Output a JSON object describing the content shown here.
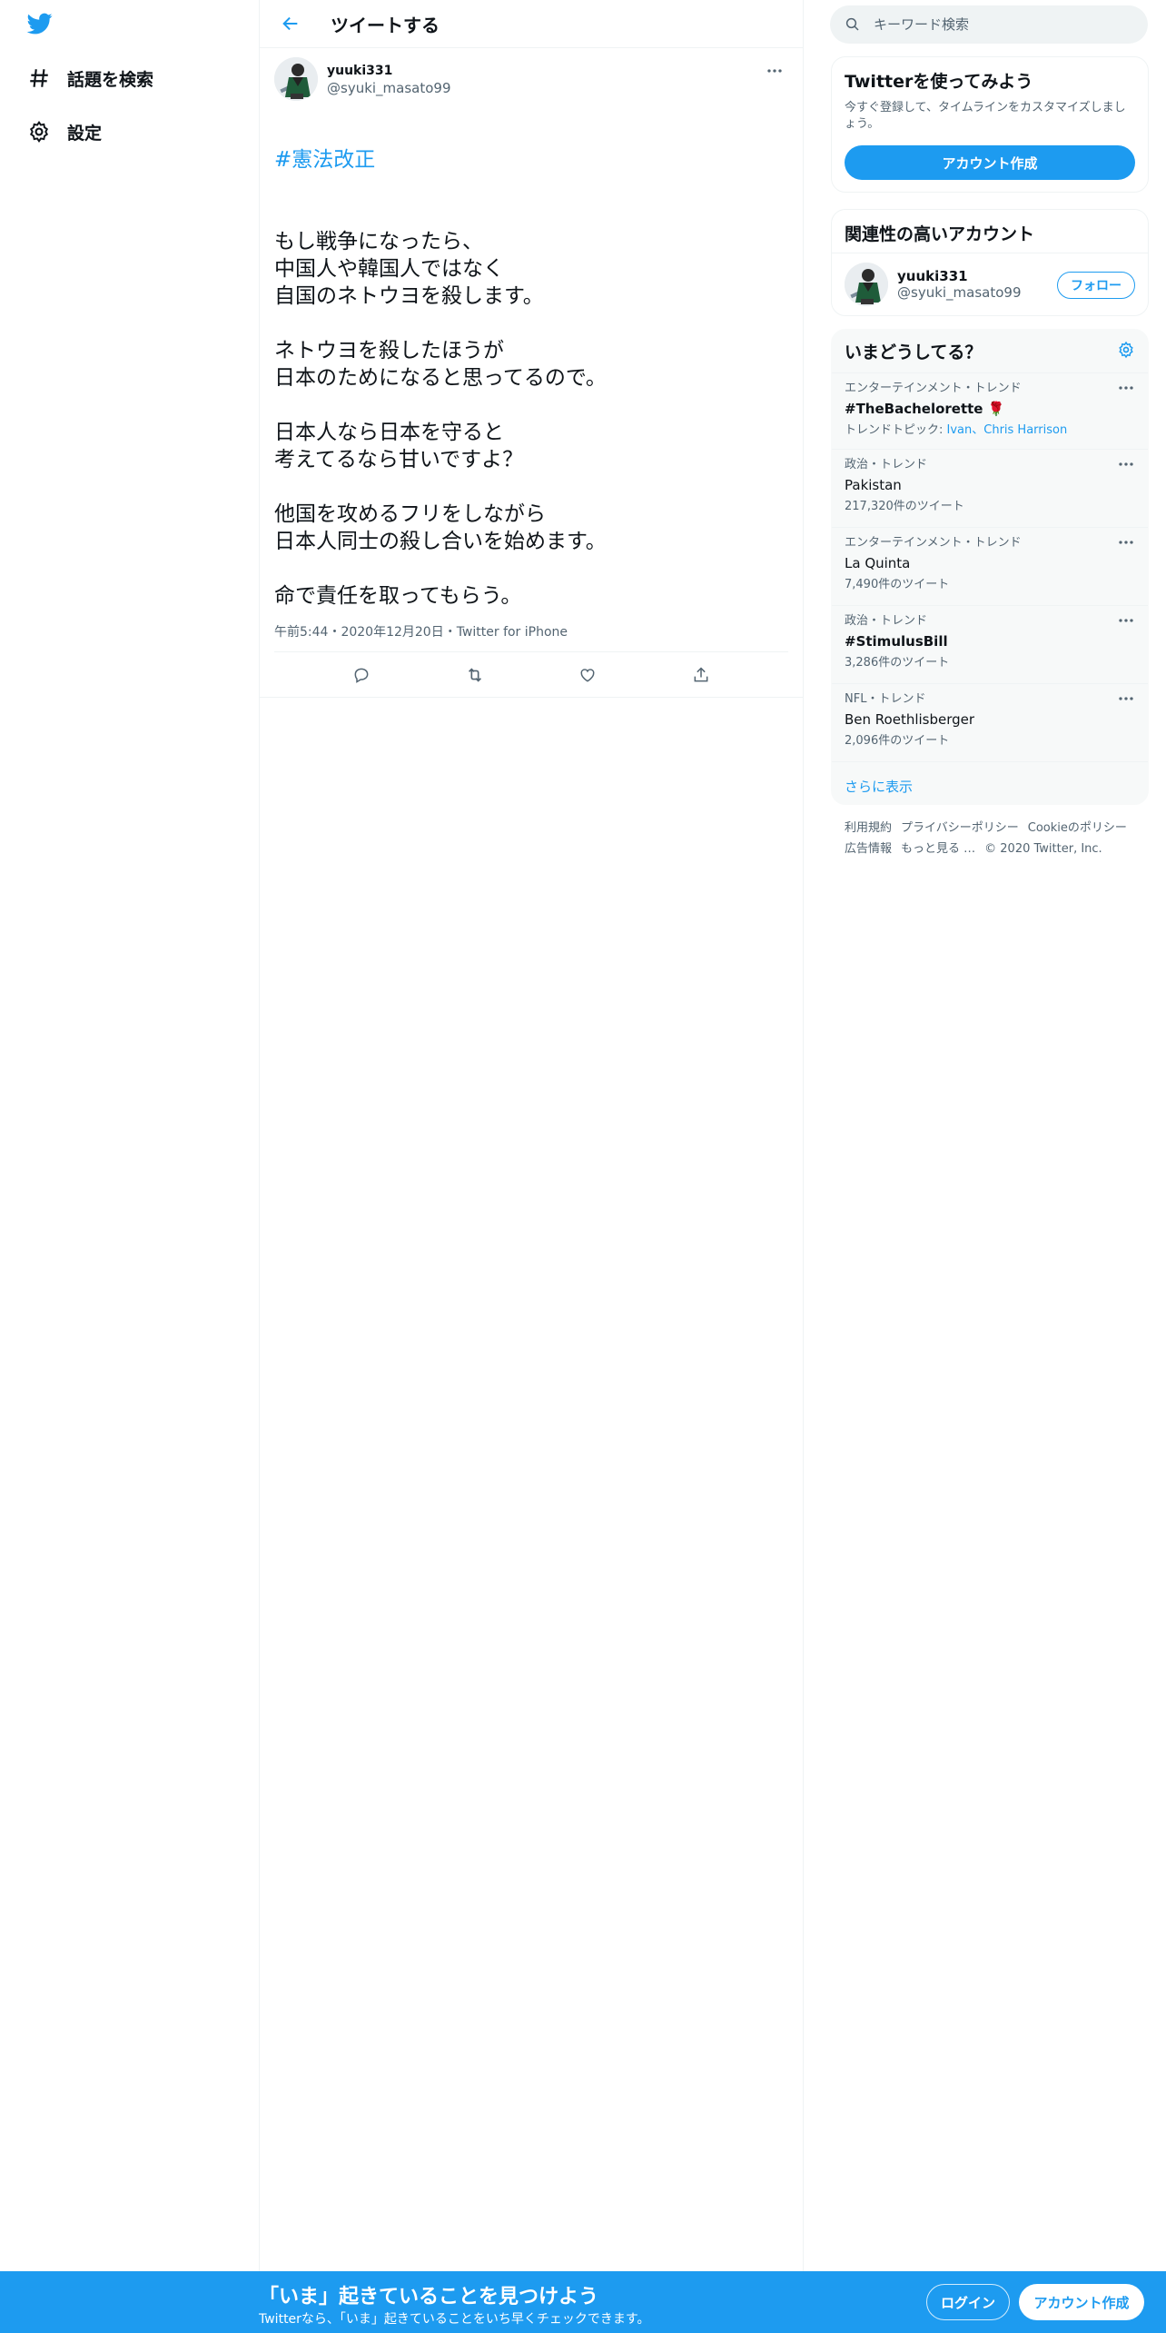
{
  "nav": {
    "explore_label": "話題を検索",
    "settings_label": "設定"
  },
  "header": {
    "title": "ツイートする"
  },
  "tweet": {
    "name": "yuuki331",
    "handle": "@syuki_masato99",
    "hashtag": "#憲法改正",
    "body": "もし戦争になったら、\n中国人や韓国人ではなく\n自国のネトウヨを殺します。\n\nネトウヨを殺したほうが\n日本のためになると思ってるので。\n\n日本人なら日本を守ると\n考えてるなら甘いですよ？\n\n他国を攻めるフリをしながら\n日本人同士の殺し合いを始めます。\n\n命で責任を取ってもらう。",
    "meta": "午前5:44・2020年12月20日・Twitter for iPhone"
  },
  "search": {
    "placeholder": "キーワード検索"
  },
  "signup_card": {
    "title": "Twitterを使ってみよう",
    "subtitle": "今すぐ登録して、タイムラインをカスタマイズしましょう。",
    "button": "アカウント作成"
  },
  "related": {
    "title": "関連性の高いアカウント",
    "name": "yuuki331",
    "handle": "@syuki_masato99",
    "follow": "フォロー"
  },
  "trends": {
    "title": "いまどうしてる？",
    "items": [
      {
        "context": "エンターテインメント・トレンド",
        "name": "#TheBachelorette 🌹",
        "extra_prefix": "トレンドトピック: ",
        "extra_links": "Ivan、Chris Harrison",
        "bold": true
      },
      {
        "context": "政治・トレンド",
        "name": "Pakistan",
        "count": "217,320件のツイート"
      },
      {
        "context": "エンターテインメント・トレンド",
        "name": "La Quinta",
        "count": "7,490件のツイート"
      },
      {
        "context": "政治・トレンド",
        "name": "#StimulusBill",
        "count": "3,286件のツイート",
        "bold": true
      },
      {
        "context": "NFL・トレンド",
        "name": "Ben Roethlisberger",
        "count": "2,096件のツイート"
      }
    ],
    "show_more": "さらに表示"
  },
  "footer": {
    "links": [
      "利用規約",
      "プライバシーポリシー",
      "Cookieのポリシー",
      "広告情報",
      "もっと見る …",
      "© 2020 Twitter, Inc."
    ]
  },
  "bottom_bar": {
    "title": "「いま」起きていることを見つけよう",
    "subtitle": "Twitterなら、「いま」起きていることをいち早くチェックできます。",
    "login": "ログイン",
    "signup": "アカウント作成"
  },
  "colors": {
    "accent": "#1d9bf0",
    "text": "#0f1419",
    "muted": "#536471"
  }
}
